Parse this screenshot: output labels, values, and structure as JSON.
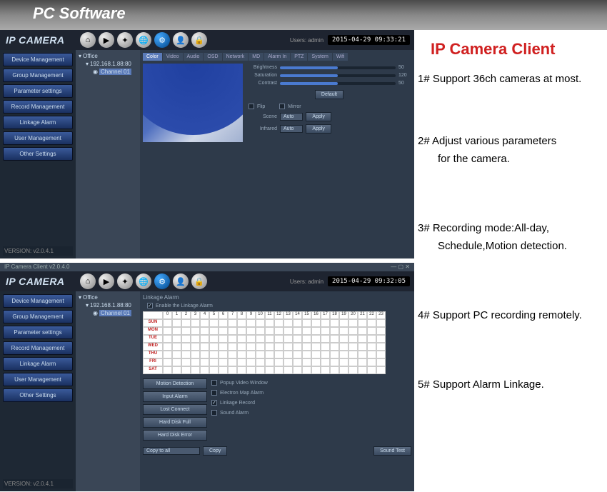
{
  "page": {
    "title": "PC Software",
    "right_title": "IP Camera Client"
  },
  "features": [
    "1# Support 36ch cameras at most.",
    "2# Adjust various parameters",
    "for the camera.",
    "3# Recording mode:All-day,",
    "Schedule,Motion detection.",
    "4# Support PC recording remotely.",
    "5# Support Alarm Linkage."
  ],
  "app": {
    "logo": "IP CAMERA",
    "users": "Users: admin",
    "version": "VERSION: v2.0.4.1",
    "titlebar2": "IP Camera Client v2.0.4.0"
  },
  "timestamps": {
    "app1": "2015-04-29 09:33:21",
    "app2": "2015-04-29 09:32:05"
  },
  "sidebar": {
    "items": [
      "Device Management",
      "Group Management",
      "Parameter settings",
      "Record Management",
      "Linkage Alarm",
      "User Management",
      "Other Settings"
    ]
  },
  "tree": {
    "root": "Office",
    "ip": "192.168.1.88:80",
    "channel": "Channel 01"
  },
  "tabs": [
    "Color",
    "Video",
    "Audio",
    "OSD",
    "Network",
    "MD",
    "Alarm In",
    "PTZ",
    "System",
    "Wifi"
  ],
  "color_controls": {
    "brightness": {
      "label": "Brightness",
      "value": "50"
    },
    "saturation": {
      "label": "Saturation",
      "value": "120"
    },
    "contrast": {
      "label": "Contrast",
      "value": "50"
    },
    "default": "Default",
    "apply": "Apply",
    "flip": "Flip",
    "mirror": "Mirror",
    "scene": {
      "label": "Scene",
      "value": "Auto"
    },
    "infrared": {
      "label": "Infrared",
      "value": "Auto"
    }
  },
  "alarm": {
    "section": "Linkage Alarm",
    "enable": "Enable the Linkage Alarm",
    "days": [
      "SUN",
      "MON",
      "TUE",
      "WED",
      "THU",
      "FRI",
      "SAT"
    ],
    "hours": [
      "0",
      "1",
      "2",
      "3",
      "4",
      "5",
      "6",
      "7",
      "8",
      "9",
      "10",
      "11",
      "12",
      "13",
      "14",
      "15",
      "16",
      "17",
      "18",
      "19",
      "20",
      "21",
      "22",
      "23"
    ],
    "buttons": [
      "Motion Detection",
      "Input Alarm",
      "Lost Connect",
      "Hard Disk Full",
      "Hard Disk Error"
    ],
    "options": [
      "Popup Video Window",
      "Electron Map Alarm",
      "Linkage Record",
      "Sound Alarm"
    ],
    "copy_to": "Copy to all",
    "copy": "Copy",
    "sound_test": "Sound Test"
  }
}
